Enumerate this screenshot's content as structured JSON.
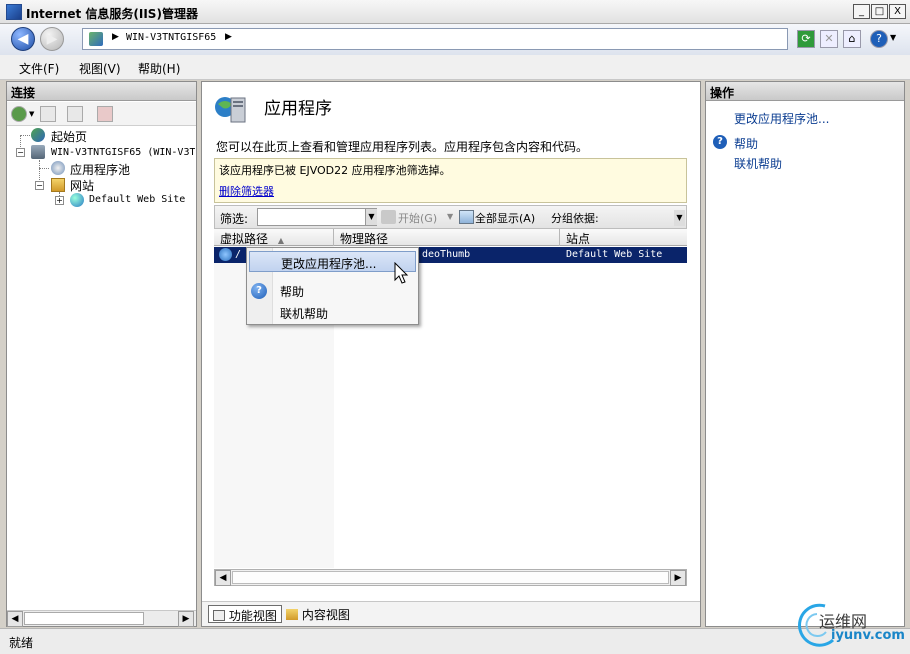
{
  "window": {
    "title": "Internet 信息服务(IIS)管理器",
    "controls": {
      "minimize": "_",
      "maximize": "□",
      "close": "X"
    }
  },
  "navbar": {
    "address_segments": [
      "WIN-V3TNTGISF65"
    ],
    "address_separator": "▶",
    "help_button": "?"
  },
  "menu": {
    "items": [
      "文件(F)",
      "视图(V)",
      "帮助(H)"
    ]
  },
  "connections": {
    "header": "连接",
    "tree": {
      "start_page": "起始页",
      "server": "WIN-V3TNTGISF65 (WIN-V3T",
      "app_pools": "应用程序池",
      "sites": "网站",
      "default_site": "Default Web Site"
    }
  },
  "center": {
    "title": "应用程序",
    "description": "您可以在此页上查看和管理应用程序列表。应用程序包含内容和代码。",
    "filter_notice": "该应用程序已被 EJVOD22 应用程序池筛选掉。",
    "remove_filter": "删除筛选器",
    "filter_label": "筛选:",
    "filter_value": "",
    "start_label": "开始(G)",
    "show_all_label": "全部显示(A)",
    "group_by_label": "分组依据:",
    "columns": [
      "虚拟路径",
      "物理路径",
      "站点"
    ],
    "row": {
      "path_visible": "/",
      "physical_path_visible": "deoThumb",
      "site": "Default Web Site"
    },
    "view_tabs": [
      "功能视图",
      "内容视图"
    ]
  },
  "context_menu": {
    "items": [
      "更改应用程序池...",
      "帮助",
      "联机帮助"
    ]
  },
  "actions": {
    "header": "操作",
    "change_pool": "更改应用程序池...",
    "help": "帮助",
    "online_help": "联机帮助"
  },
  "status": {
    "text": "就绪"
  },
  "watermark": {
    "text_cn": "运维网",
    "text_en": "iyunv.com"
  },
  "colors": {
    "selection": "#0a246a",
    "link": "#0000cc",
    "action": "#0b3d91",
    "notice_bg": "#fffbe0"
  }
}
